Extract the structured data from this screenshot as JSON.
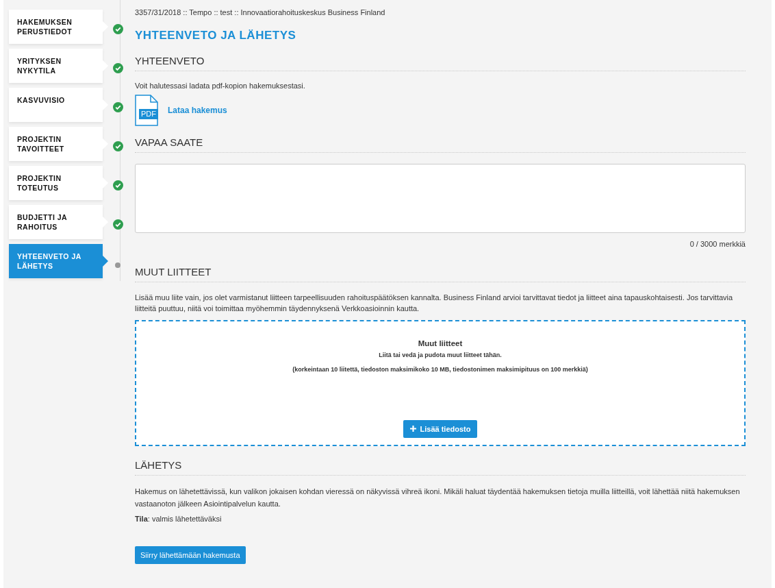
{
  "steps": [
    {
      "label": "HAKEMUKSEN PERUSTIEDOT",
      "selected": false,
      "done": true
    },
    {
      "label": "YRITYKSEN NYKYTILA",
      "selected": false,
      "done": true
    },
    {
      "label": "KASVUVISIO",
      "selected": false,
      "done": true
    },
    {
      "label": "PROJEKTIN TAVOITTEET",
      "selected": false,
      "done": true
    },
    {
      "label": "PROJEKTIN TOTEUTUS",
      "selected": false,
      "done": true
    },
    {
      "label": "BUDJETTI JA RAHOITUS",
      "selected": false,
      "done": true
    },
    {
      "label": "YHTEENVETO JA LÄHETYS",
      "selected": true,
      "done": false
    }
  ],
  "breadcrumb": "3357/31/2018 :: Tempo :: test :: Innovaatiorahoituskeskus Business Finland",
  "title": "YHTEENVETO JA LÄHETYS",
  "summary": {
    "heading": "YHTEENVETO",
    "text": "Voit halutessasi ladata pdf-kopion hakemuksestasi.",
    "pdf_label": "PDF",
    "download_link": "Lataa hakemus"
  },
  "cover_letter": {
    "heading": "VAPAA SAATE",
    "counter": "0 / 3000 merkkiä"
  },
  "attachments": {
    "heading": "MUUT LIITTEET",
    "text": "Lisää muu liite vain, jos olet varmistanut liitteen tarpeellisuuden rahoituspäätöksen kannalta. Business Finland arvioi tarvittavat tiedot ja liitteet aina tapauskohtaisesti. Jos tarvittavia liitteitä puuttuu, niitä voi toimittaa myöhemmin täydennyksenä Verkkoasioinnin kautta.",
    "drop_title": "Muut liitteet",
    "drop_hint": "Liitä tai vedä ja pudota muut liitteet tähän.",
    "drop_limits": "(korkeintaan 10 liitettä, tiedoston maksimikoko 10 MB, tiedostonimen maksimipituus on 100 merkkiä)",
    "add_button": "Lisää tiedosto"
  },
  "sending": {
    "heading": "LÄHETYS",
    "text": "Hakemus on lähetettävissä, kun valikon jokaisen kohdan vieressä on näkyvissä vihreä ikoni. Mikäli haluat täydentää hakemuksen tietoja muilla liitteillä, voit lähettää niitä hakemuksen vastaanoton jälkeen Asiointipalvelun kautta.",
    "status": "**Tila**: valmis lähetettäväksi",
    "button": "Siirry lähettämään hakemusta"
  }
}
